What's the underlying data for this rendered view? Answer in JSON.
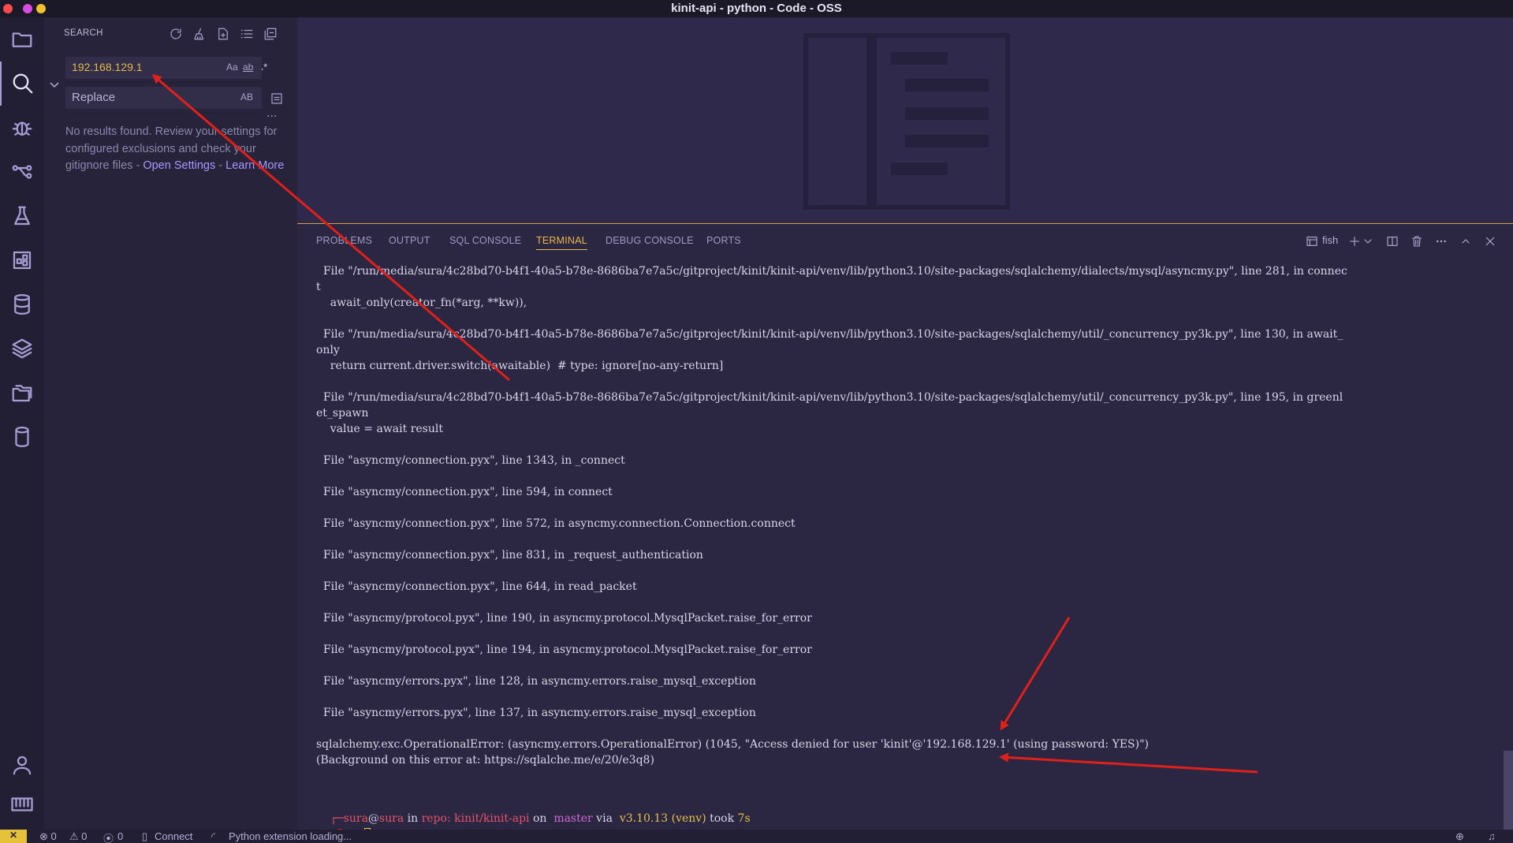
{
  "window": {
    "title": "kinit-api - python - Code - OSS"
  },
  "colors": {
    "accent": "#e8b84a",
    "annotation": "#e0201b",
    "link": "#a996ff"
  },
  "sidebar": {
    "heading": "SEARCH",
    "search_value": "192.168.129.1",
    "search_opts": [
      "Aa",
      "ab",
      ".*"
    ],
    "replace_placeholder": "Replace",
    "replace_opt": "AB",
    "more": "···",
    "no_results_text": "No results found. Review your settings for configured exclusions and check your gitignore files - ",
    "open_settings": "Open Settings",
    "dash": " - ",
    "learn_more": "Learn More"
  },
  "panel": {
    "tabs": [
      "PROBLEMS",
      "OUTPUT",
      "SQL CONSOLE",
      "TERMINAL",
      "DEBUG CONSOLE",
      "PORTS"
    ],
    "active_tab": "TERMINAL",
    "shell": "fish"
  },
  "terminal": {
    "lines": [
      "  File \"/run/media/sura/4c28bd70-b4f1-40a5-b78e-8686ba7e7a5c/gitproject/kinit/kinit-api/venv/lib/python3.10/site-packages/sqlalchemy/dialects/mysql/asyncmy.py\", line 281, in connec",
      "t",
      "    await_only(creator_fn(*arg, **kw)),",
      "",
      "  File \"/run/media/sura/4c28bd70-b4f1-40a5-b78e-8686ba7e7a5c/gitproject/kinit/kinit-api/venv/lib/python3.10/site-packages/sqlalchemy/util/_concurrency_py3k.py\", line 130, in await_",
      "only",
      "    return current.driver.switch(awaitable)  # type: ignore[no-any-return]",
      "",
      "  File \"/run/media/sura/4c28bd70-b4f1-40a5-b78e-8686ba7e7a5c/gitproject/kinit/kinit-api/venv/lib/python3.10/site-packages/sqlalchemy/util/_concurrency_py3k.py\", line 195, in greenl",
      "et_spawn",
      "    value = await result",
      "",
      "  File \"asyncmy/connection.pyx\", line 1343, in _connect",
      "",
      "  File \"asyncmy/connection.pyx\", line 594, in connect",
      "",
      "  File \"asyncmy/connection.pyx\", line 572, in asyncmy.connection.Connection.connect",
      "",
      "  File \"asyncmy/connection.pyx\", line 831, in _request_authentication",
      "",
      "  File \"asyncmy/connection.pyx\", line 644, in read_packet",
      "",
      "  File \"asyncmy/protocol.pyx\", line 190, in asyncmy.protocol.MysqlPacket.raise_for_error",
      "",
      "  File \"asyncmy/protocol.pyx\", line 194, in asyncmy.protocol.MysqlPacket.raise_for_error",
      "",
      "  File \"asyncmy/errors.pyx\", line 128, in asyncmy.errors.raise_mysql_exception",
      "",
      "  File \"asyncmy/errors.pyx\", line 137, in asyncmy.errors.raise_mysql_exception",
      "",
      "sqlalchemy.exc.OperationalError: (asyncmy.errors.OperationalError) (1045, \"Access denied for user 'kinit'@'192.168.129.1' (using password: YES)\")",
      "(Background on this error at: https://sqlalche.me/e/20/e3q8)"
    ],
    "prompt": {
      "user": "sura",
      "at": "@",
      "host": "sura",
      "in": " in ",
      "repo": "repo: kinit/kinit-api",
      "on": " on  ",
      "branch": "master",
      "via": " via  ",
      "python": "v3.10.13 (venv)",
      "took": " took ",
      "duration": "7s",
      "status": "[",
      "status_close": "]",
      "x": " ✕"
    }
  },
  "statusbar": {
    "remote": "✕",
    "errors": "⊗ 0",
    "warnings": "⚠ 0",
    "ports": "0",
    "connect": "Connect",
    "python": "Python extension loading..."
  }
}
